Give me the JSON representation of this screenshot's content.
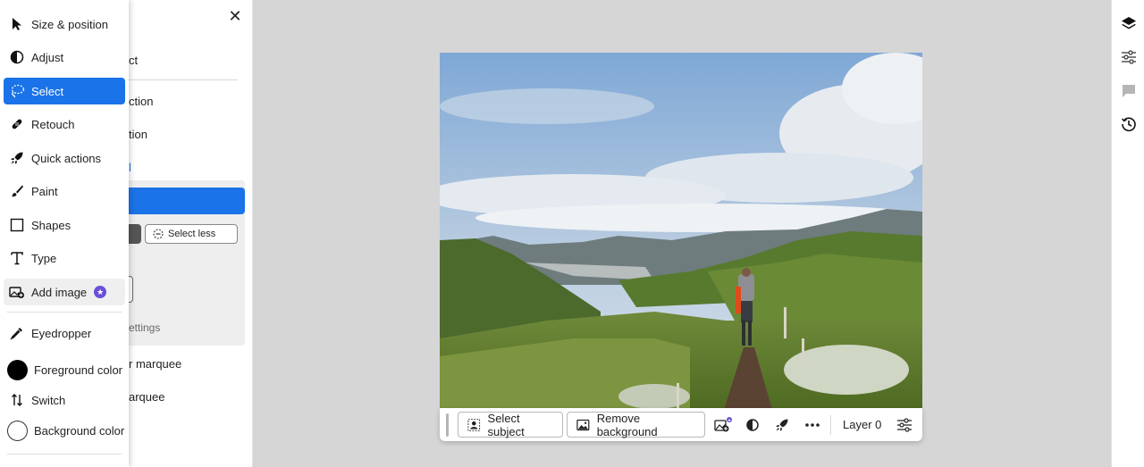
{
  "side_panel": {
    "close_icon": "close-icon",
    "partial_items": [
      "ct",
      "ction",
      "tion",
      "l"
    ],
    "select_less_label": "Select less",
    "settings_fragment": "ettings",
    "marquee_items": [
      "r marquee",
      "arquee"
    ]
  },
  "tool_menu": {
    "items": [
      {
        "label": "Size & position",
        "icon": "pointer-icon"
      },
      {
        "label": "Adjust",
        "icon": "adjust-icon"
      },
      {
        "label": "Select",
        "icon": "lasso-icon",
        "active": true
      },
      {
        "label": "Retouch",
        "icon": "bandage-icon"
      },
      {
        "label": "Quick actions",
        "icon": "rocket-icon"
      },
      {
        "label": "Paint",
        "icon": "brush-icon"
      },
      {
        "label": "Shapes",
        "icon": "square-icon"
      },
      {
        "label": "Type",
        "icon": "type-icon"
      },
      {
        "label": "Add image",
        "icon": "add-image-icon",
        "badge": "premium-star-icon"
      },
      {
        "label": "Eyedropper",
        "icon": "eyedropper-icon"
      },
      {
        "label": "Foreground color",
        "icon": "foreground-swatch",
        "color": "#000000"
      },
      {
        "label": "Switch",
        "icon": "swap-arrows-icon"
      },
      {
        "label": "Background color",
        "icon": "background-swatch",
        "color": "#ffffff"
      }
    ]
  },
  "canvas": {
    "image_description_icon": "landscape-photo"
  },
  "task_bar": {
    "select_subject_label": "Select subject",
    "remove_background_label": "Remove background",
    "layer_label": "Layer 0",
    "icons": [
      "add-image-icon",
      "adjust-icon",
      "rocket-icon",
      "more-icon",
      "settings-sliders-icon"
    ]
  },
  "right_rail": {
    "icons": [
      "layers-icon",
      "properties-icon",
      "comments-icon",
      "history-icon"
    ]
  },
  "colors": {
    "accent": "#1a73e8",
    "workspace": "#d6d6d6",
    "badge": "#6b4fd8"
  }
}
